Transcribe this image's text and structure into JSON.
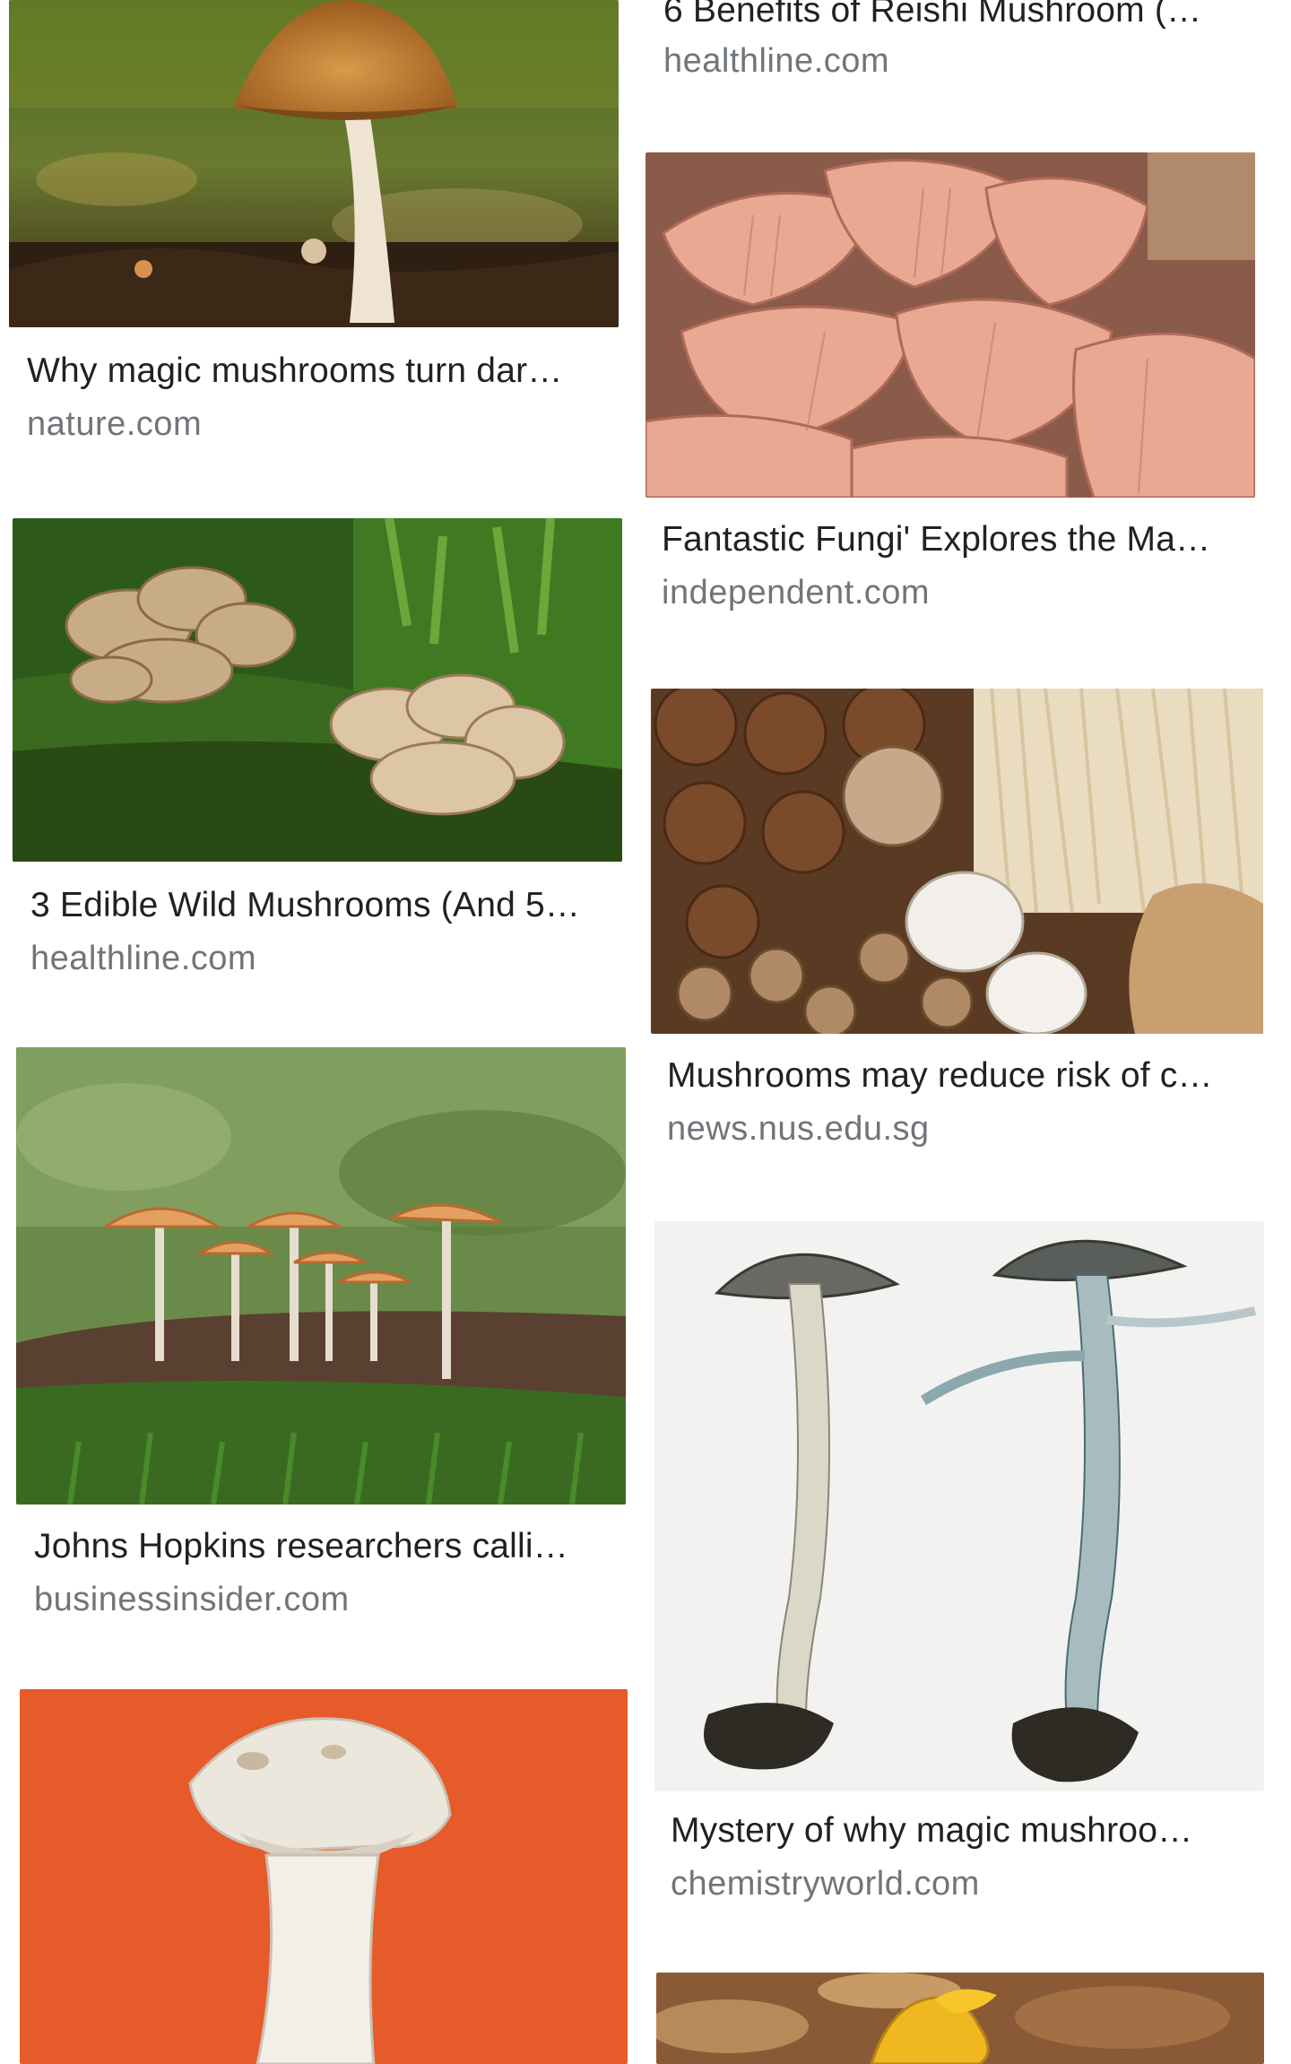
{
  "results": [
    {
      "title": "6 Benefits of Reishi Mushroom (…",
      "source": "healthline.com",
      "image": "reishi-mushroom-image"
    },
    {
      "title": "Why magic mushrooms turn dar…",
      "source": "nature.com",
      "image": "brown-cap-mushroom-image"
    },
    {
      "title": "Fantastic Fungi' Explores the Ma…",
      "source": "independent.com",
      "image": "pink-oyster-mushroom-image"
    },
    {
      "title": "3 Edible Wild Mushrooms (And 5…",
      "source": "healthline.com",
      "image": "maitake-mushroom-image"
    },
    {
      "title": "Mushrooms may reduce risk of c…",
      "source": "news.nus.edu.sg",
      "image": "assorted-mushrooms-image"
    },
    {
      "title": "Johns Hopkins researchers calli…",
      "source": "businessinsider.com",
      "image": "psilocybe-cluster-image"
    },
    {
      "title": "Mystery of why magic mushroo…",
      "source": "chemistryworld.com",
      "image": "bluing-psilocybe-image"
    },
    {
      "title": "",
      "source": "",
      "image": "white-button-mushroom-image"
    },
    {
      "title": "",
      "source": "",
      "image": "chanterelle-leaves-image"
    }
  ],
  "colors": {
    "title": "#202124",
    "source": "#70757a",
    "orange_background": "#e75a2a"
  }
}
